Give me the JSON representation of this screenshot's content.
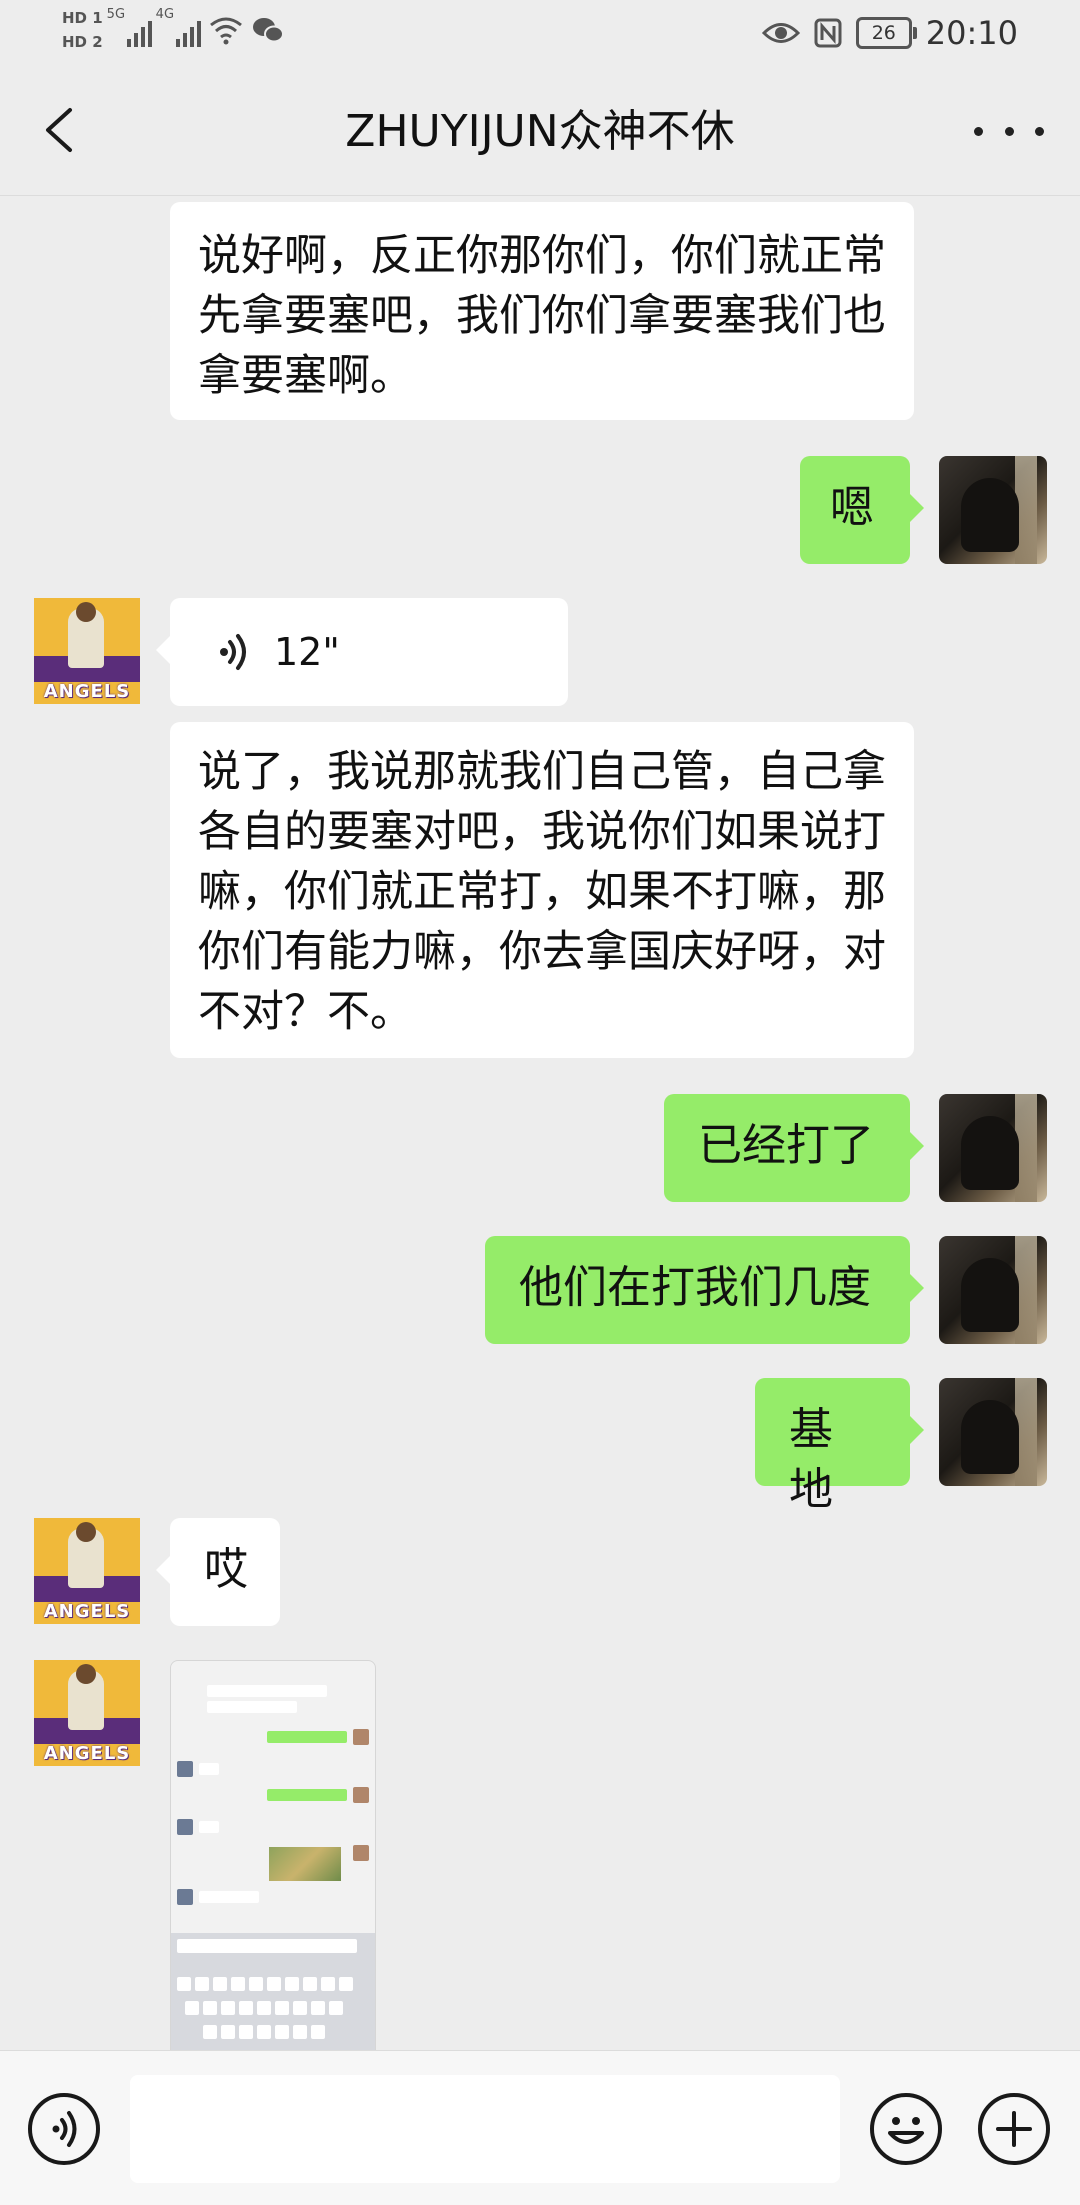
{
  "status_bar": {
    "hd1": "HD 1",
    "hd2": "HD 2",
    "net1": "5G",
    "net2": "4G",
    "battery": "26",
    "time": "20:10"
  },
  "header": {
    "title": "ZHUYIJUN众神不休"
  },
  "messages": [
    {
      "side": "left",
      "type": "text",
      "text": "说好啊，反正你那你们，你们就正常先拿要塞吧，我们你们拿要塞我们也拿要塞啊。"
    },
    {
      "side": "right",
      "type": "text",
      "text": "嗯"
    },
    {
      "side": "left",
      "type": "voice",
      "duration": "12\""
    },
    {
      "side": "left",
      "type": "text",
      "text": "说了，我说那就我们自己管，自己拿各自的要塞对吧，我说你们如果说打嘛，你们就正常打，如果不打嘛，那你们有能力嘛，你去拿国庆好呀，对不对？不。"
    },
    {
      "side": "right",
      "type": "text",
      "text": "已经打了"
    },
    {
      "side": "right",
      "type": "text",
      "text": "他们在打我们几度"
    },
    {
      "side": "right",
      "type": "text",
      "text": "基地"
    },
    {
      "side": "left",
      "type": "text",
      "text": "哎"
    },
    {
      "side": "left",
      "type": "image"
    }
  ],
  "avatars": {
    "other_label": "ANGELS"
  },
  "input_bar": {
    "placeholder": "",
    "icons": [
      "voice-icon",
      "emoji-icon",
      "plus-icon"
    ]
  },
  "colors": {
    "background": "#ededed",
    "my_bubble": "#95ec69",
    "their_bubble": "#ffffff"
  }
}
